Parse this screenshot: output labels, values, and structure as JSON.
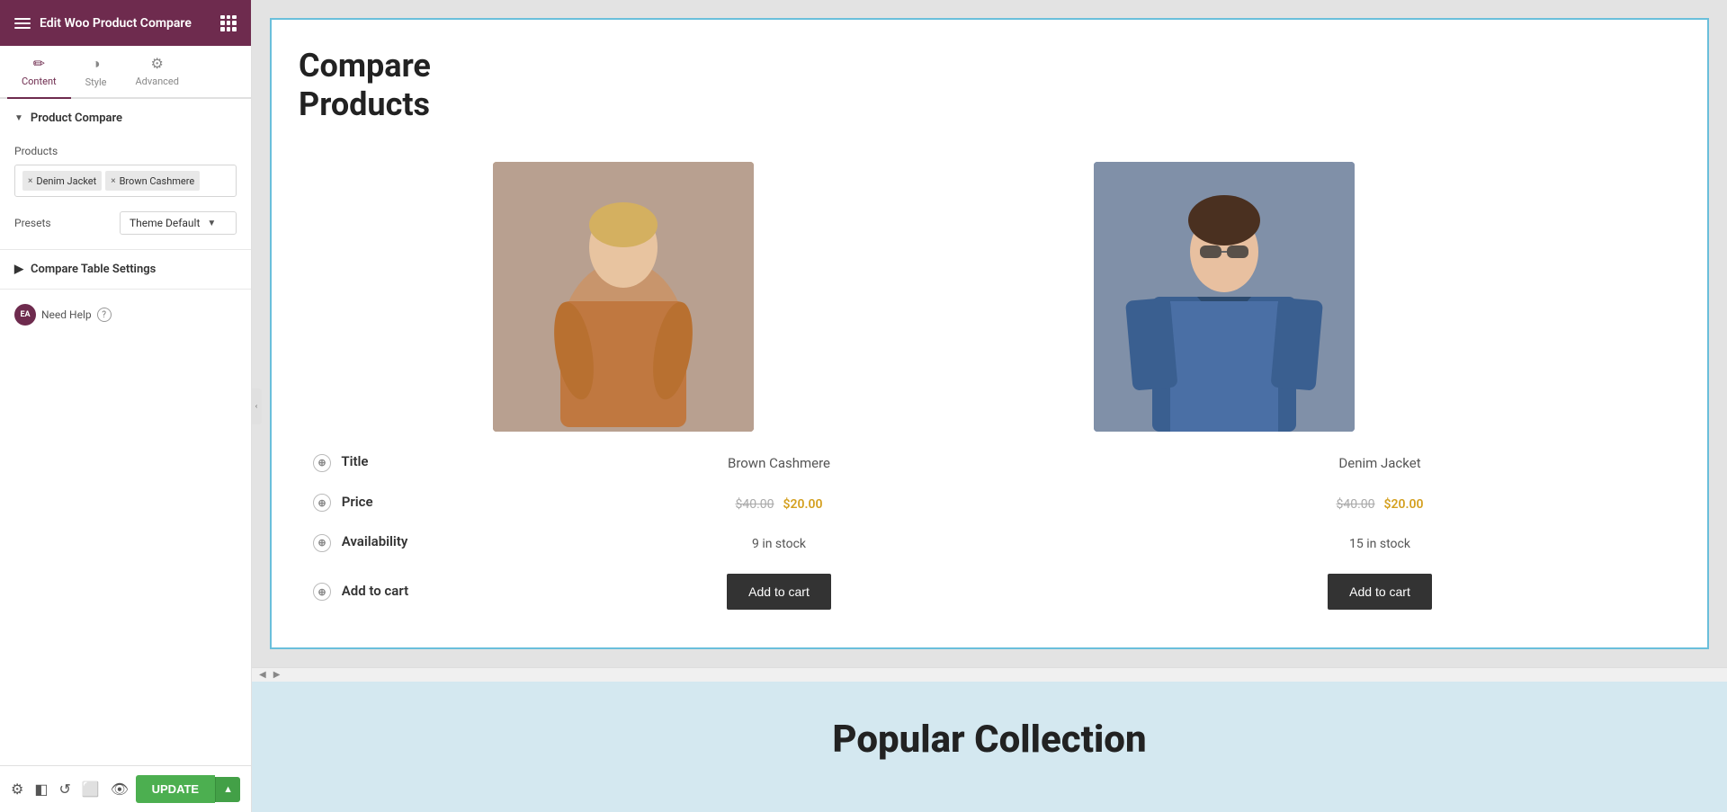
{
  "header": {
    "title": "Edit Woo Product Compare",
    "hamburger_label": "menu",
    "grid_label": "apps"
  },
  "tabs": [
    {
      "id": "content",
      "label": "Content",
      "icon": "✏️",
      "active": true
    },
    {
      "id": "style",
      "label": "Style",
      "icon": "🎨",
      "active": false
    },
    {
      "id": "advanced",
      "label": "Advanced",
      "icon": "⚙️",
      "active": false
    }
  ],
  "sections": {
    "product_compare": {
      "label": "Product Compare",
      "expanded": true,
      "fields": {
        "products_label": "Products",
        "tags": [
          {
            "text": "Denim Jacket",
            "removable": true
          },
          {
            "text": "Brown Cashmere",
            "removable": true
          }
        ],
        "presets_label": "Presets",
        "presets_value": "Theme Default"
      }
    },
    "compare_table_settings": {
      "label": "Compare Table Settings",
      "expanded": false
    }
  },
  "need_help": {
    "badge": "EA",
    "label": "Need Help",
    "help_icon": "?"
  },
  "bottom_toolbar": {
    "update_label": "UPDATE",
    "icons": [
      "⚙",
      "◧",
      "↺",
      "⬜",
      "👁"
    ]
  },
  "canvas": {
    "widget_title": "Compare Products",
    "products": [
      {
        "name": "Brown Cashmere",
        "image_style": "cashmere-brown",
        "original_price": "$40.00",
        "sale_price": "$20.00",
        "availability": "9 in stock",
        "add_to_cart": "Add to cart"
      },
      {
        "name": "Denim Jacket",
        "image_style": "jacket-denim",
        "original_price": "$40.00",
        "sale_price": "$20.00",
        "availability": "15 in stock",
        "add_to_cart": "Add to cart"
      }
    ],
    "compare_rows": [
      {
        "label": "Title"
      },
      {
        "label": "Price"
      },
      {
        "label": "Availability"
      },
      {
        "label": "Add to cart"
      }
    ]
  },
  "lower_section": {
    "title": "Popular Collection"
  }
}
